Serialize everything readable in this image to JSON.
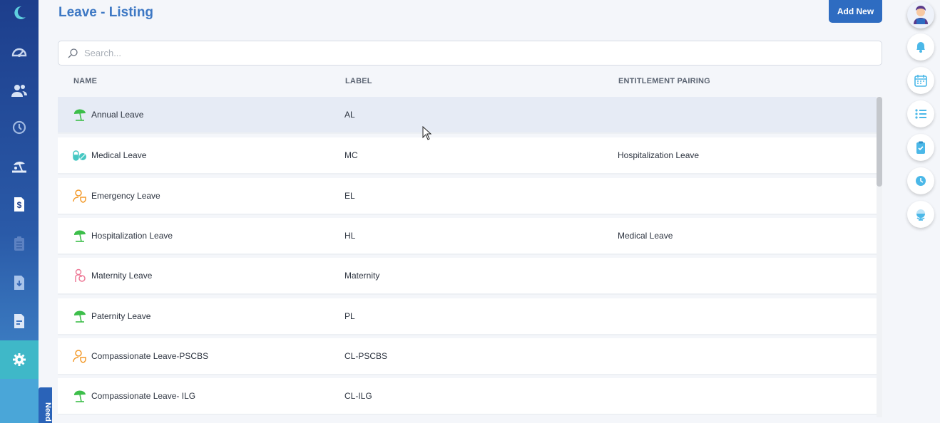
{
  "page": {
    "title": "Leave - Listing",
    "add_new_label": "Add New"
  },
  "search": {
    "placeholder": "Search...",
    "value": ""
  },
  "table": {
    "headers": {
      "name": "NAME",
      "label": "LABEL",
      "pairing": "ENTITLEMENT PAIRING"
    },
    "rows": [
      {
        "name": "Annual Leave",
        "label": "AL",
        "pairing": "",
        "icon": "beach-umbrella-icon"
      },
      {
        "name": "Medical Leave",
        "label": "MC",
        "pairing": "Hospitalization Leave",
        "icon": "pills-icon"
      },
      {
        "name": "Emergency Leave",
        "label": "EL",
        "pairing": "",
        "icon": "person-shield-icon"
      },
      {
        "name": "Hospitalization Leave",
        "label": "HL",
        "pairing": "Medical Leave",
        "icon": "beach-umbrella-icon"
      },
      {
        "name": "Maternity Leave",
        "label": "Maternity",
        "pairing": "",
        "icon": "maternity-icon"
      },
      {
        "name": "Paternity Leave",
        "label": "PL",
        "pairing": "",
        "icon": "beach-umbrella-icon"
      },
      {
        "name": "Compassionate Leave-PSCBS",
        "label": "CL-PSCBS",
        "pairing": "",
        "icon": "person-shield-icon"
      },
      {
        "name": "Compassionate Leave- ILG",
        "label": "CL-ILG",
        "pairing": "",
        "icon": "beach-umbrella-icon"
      }
    ]
  },
  "sidebar": {
    "items": [
      "moon-logo-icon",
      "dashboard-gauge-icon",
      "people-icon",
      "history-clock-icon",
      "beach-leave-icon",
      "dollar-document-icon",
      "clipboard-list-icon",
      "download-document-icon",
      "document-lines-icon",
      "gear-icon"
    ],
    "active": "gear-icon"
  },
  "help_tab": {
    "label": "Need"
  },
  "right_rail": [
    "avatar",
    "bell-icon",
    "calendar-icon",
    "list-icon",
    "clipboard-check-icon",
    "clock-icon",
    "globe-icon"
  ],
  "colors": {
    "primary": "#2e6cc1",
    "title": "#3d78c4",
    "active_side": "#3fb8c8",
    "row_hover": "#e6ebf5",
    "umbrella": "#3dbe4a",
    "pill": "#45c7c2",
    "person": "#f39a2b",
    "maternity": "#ee7b98"
  }
}
